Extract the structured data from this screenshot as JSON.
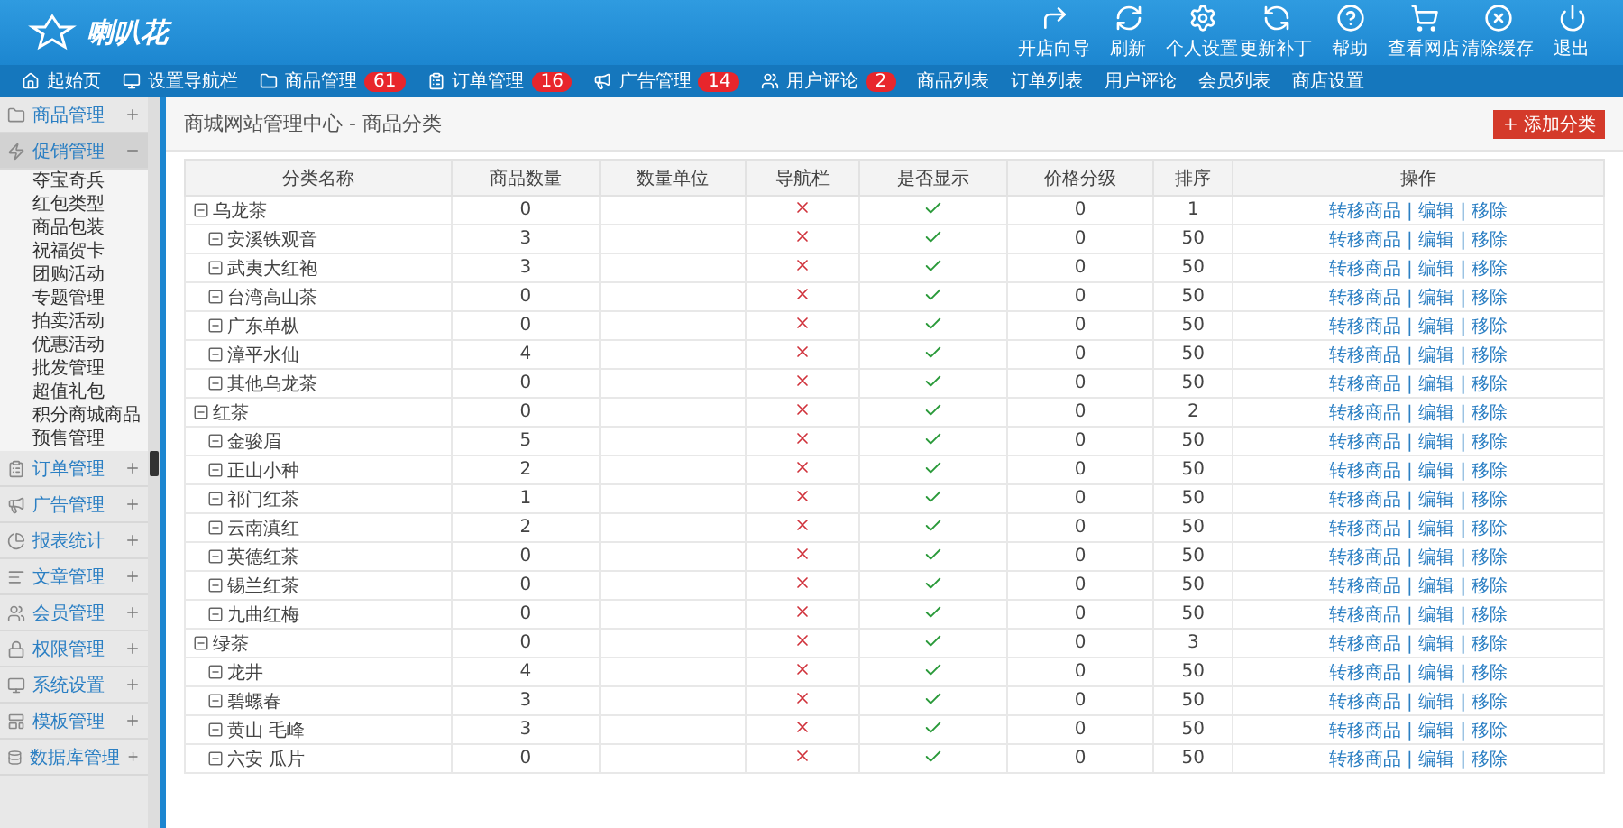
{
  "brand": "喇叭花",
  "toolbar": [
    "开店向导",
    "刷新",
    "个人设置",
    "更新补丁",
    "帮助",
    "查看网店",
    "清除缓存",
    "退出"
  ],
  "nav": [
    {
      "label": "起始页"
    },
    {
      "label": "设置导航栏"
    },
    {
      "label": "商品管理",
      "badge": "61"
    },
    {
      "label": "订单管理",
      "badge": "16"
    },
    {
      "label": "广告管理",
      "badge": "14"
    },
    {
      "label": "用户评论",
      "badge": "2"
    },
    {
      "label": "商品列表"
    },
    {
      "label": "订单列表"
    },
    {
      "label": "用户评论"
    },
    {
      "label": "会员列表"
    },
    {
      "label": "商店设置"
    }
  ],
  "sidebar": {
    "items": [
      {
        "label": "商品管理",
        "expanded": false
      },
      {
        "label": "促销管理",
        "expanded": true,
        "children": [
          "夺宝奇兵",
          "红包类型",
          "商品包装",
          "祝福贺卡",
          "团购活动",
          "专题管理",
          "拍卖活动",
          "优惠活动",
          "批发管理",
          "超值礼包",
          "积分商城商品",
          "预售管理"
        ]
      },
      {
        "label": "订单管理",
        "expanded": false
      },
      {
        "label": "广告管理",
        "expanded": false
      },
      {
        "label": "报表统计",
        "expanded": false
      },
      {
        "label": "文章管理",
        "expanded": false
      },
      {
        "label": "会员管理",
        "expanded": false
      },
      {
        "label": "权限管理",
        "expanded": false
      },
      {
        "label": "系统设置",
        "expanded": false
      },
      {
        "label": "模板管理",
        "expanded": false
      },
      {
        "label": "数据库管理",
        "expanded": false
      }
    ]
  },
  "page_title": "商城网站管理中心 - 商品分类",
  "add_button": "+ 添加分类",
  "table": {
    "columns": [
      "分类名称",
      "商品数量",
      "数量单位",
      "导航栏",
      "是否显示",
      "价格分级",
      "排序",
      "操作"
    ],
    "rows": [
      {
        "name": "乌龙茶",
        "count": "0",
        "in_nav": false,
        "shown": true,
        "grade": "0",
        "sort": "1",
        "actions": "转移商品 | 编辑 | 移除",
        "children": [
          {
            "name": "安溪铁观音",
            "count": "3",
            "in_nav": false,
            "shown": true,
            "grade": "0",
            "sort": "50",
            "actions": "转移商品 | 编辑 | 移除"
          },
          {
            "name": "武夷大红袍",
            "count": "3",
            "in_nav": false,
            "shown": true,
            "grade": "0",
            "sort": "50",
            "actions": "转移商品 | 编辑 | 移除"
          },
          {
            "name": "台湾高山茶",
            "count": "0",
            "in_nav": false,
            "shown": true,
            "grade": "0",
            "sort": "50",
            "actions": "转移商品 | 编辑 | 移除"
          },
          {
            "name": "广东单枞",
            "count": "0",
            "in_nav": false,
            "shown": true,
            "grade": "0",
            "sort": "50",
            "actions": "转移商品 | 编辑 | 移除"
          },
          {
            "name": "漳平水仙",
            "count": "4",
            "in_nav": false,
            "shown": true,
            "grade": "0",
            "sort": "50",
            "actions": "转移商品 | 编辑 | 移除"
          },
          {
            "name": "其他乌龙茶",
            "count": "0",
            "in_nav": false,
            "shown": true,
            "grade": "0",
            "sort": "50",
            "actions": "转移商品 | 编辑 | 移除"
          }
        ]
      },
      {
        "name": "红茶",
        "count": "0",
        "in_nav": false,
        "shown": true,
        "grade": "0",
        "sort": "2",
        "actions": "转移商品 | 编辑 | 移除",
        "children": [
          {
            "name": "金骏眉",
            "count": "5",
            "in_nav": false,
            "shown": true,
            "grade": "0",
            "sort": "50",
            "actions": "转移商品 | 编辑 | 移除"
          },
          {
            "name": "正山小种",
            "count": "2",
            "in_nav": false,
            "shown": true,
            "grade": "0",
            "sort": "50",
            "actions": "转移商品 | 编辑 | 移除"
          },
          {
            "name": "祁门红茶",
            "count": "1",
            "in_nav": false,
            "shown": true,
            "grade": "0",
            "sort": "50",
            "actions": "转移商品 | 编辑 | 移除"
          },
          {
            "name": "云南滇红",
            "count": "2",
            "in_nav": false,
            "shown": true,
            "grade": "0",
            "sort": "50",
            "actions": "转移商品 | 编辑 | 移除"
          },
          {
            "name": "英德红茶",
            "count": "0",
            "in_nav": false,
            "shown": true,
            "grade": "0",
            "sort": "50",
            "actions": "转移商品 | 编辑 | 移除"
          },
          {
            "name": "锡兰红茶",
            "count": "0",
            "in_nav": false,
            "shown": true,
            "grade": "0",
            "sort": "50",
            "actions": "转移商品 | 编辑 | 移除"
          },
          {
            "name": "九曲红梅",
            "count": "0",
            "in_nav": false,
            "shown": true,
            "grade": "0",
            "sort": "50",
            "actions": "转移商品 | 编辑 | 移除"
          }
        ]
      },
      {
        "name": "绿茶",
        "count": "0",
        "in_nav": false,
        "shown": true,
        "grade": "0",
        "sort": "3",
        "actions": "转移商品 | 编辑 | 移除",
        "children": [
          {
            "name": "龙井",
            "count": "4",
            "in_nav": false,
            "shown": true,
            "grade": "0",
            "sort": "50",
            "actions": "转移商品 | 编辑 | 移除"
          },
          {
            "name": "碧螺春",
            "count": "3",
            "in_nav": false,
            "shown": true,
            "grade": "0",
            "sort": "50",
            "actions": "转移商品 | 编辑 | 移除"
          },
          {
            "name": "黄山 毛峰",
            "count": "3",
            "in_nav": false,
            "shown": true,
            "grade": "0",
            "sort": "50",
            "actions": "转移商品 | 编辑 | 移除"
          },
          {
            "name": "六安 瓜片",
            "count": "0",
            "in_nav": false,
            "shown": true,
            "grade": "0",
            "sort": "50",
            "actions": "转移商品 | 编辑 | 移除"
          }
        ]
      }
    ]
  }
}
